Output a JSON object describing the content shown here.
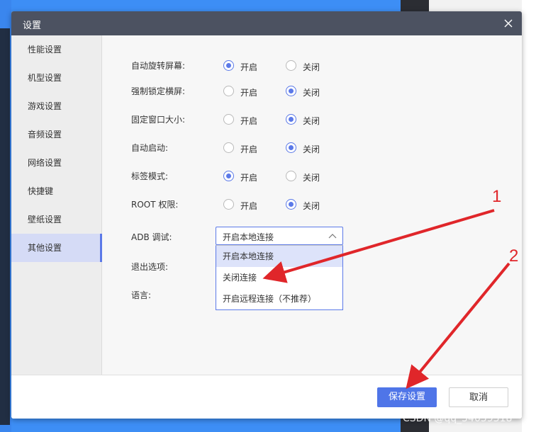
{
  "dialog": {
    "title": "设置"
  },
  "sidebar": {
    "items": [
      {
        "label": "性能设置"
      },
      {
        "label": "机型设置"
      },
      {
        "label": "游戏设置"
      },
      {
        "label": "音频设置"
      },
      {
        "label": "网络设置"
      },
      {
        "label": "快捷键"
      },
      {
        "label": "壁纸设置"
      },
      {
        "label": "其他设置"
      }
    ],
    "active_index": 7
  },
  "settings": [
    {
      "label": "自动旋转屏幕:",
      "on_label": "开启",
      "off_label": "关闭",
      "value": "on"
    },
    {
      "label": "强制锁定横屏:",
      "on_label": "开启",
      "off_label": "关闭",
      "value": "off"
    },
    {
      "label": "固定窗口大小:",
      "on_label": "开启",
      "off_label": "关闭",
      "value": "off"
    },
    {
      "label": "自动启动:",
      "on_label": "开启",
      "off_label": "关闭",
      "value": "off"
    },
    {
      "label": "标签模式:",
      "on_label": "开启",
      "off_label": "关闭",
      "value": "on"
    },
    {
      "label": "ROOT 权限:",
      "on_label": "开启",
      "off_label": "关闭",
      "value": "off"
    }
  ],
  "adb": {
    "label": "ADB 调试:",
    "selected": "开启本地连接",
    "options": [
      "开启本地连接",
      "关闭连接",
      "开启远程连接（不推荐）"
    ],
    "highlighted_index": 0
  },
  "exit_option": {
    "label": "退出选项:"
  },
  "language": {
    "label": "语言:"
  },
  "footer": {
    "save_label": "保存设置",
    "cancel_label": "取消"
  },
  "annotations": {
    "marker_1": "1",
    "marker_2": "2",
    "arrow_color": "#e0262a"
  },
  "watermark": "CSDN @qq_54059318",
  "colors": {
    "accent": "#5b79e8",
    "titlebar": "#4c5261",
    "primary_button": "#4f75e8"
  }
}
